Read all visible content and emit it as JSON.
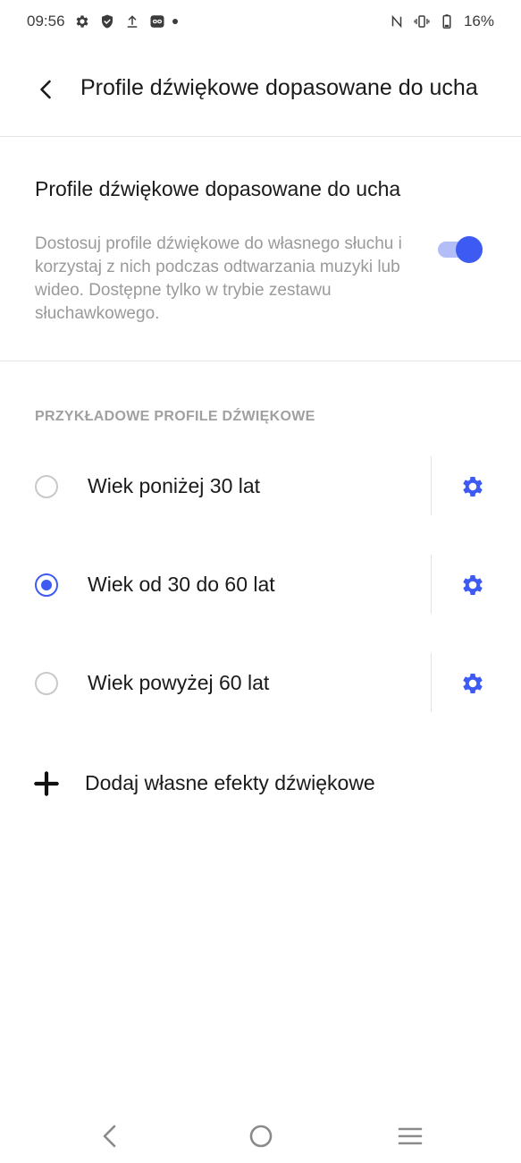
{
  "status_bar": {
    "time": "09:56",
    "left_icons": [
      "settings-icon",
      "shield-icon",
      "upload-icon",
      "link-app-icon",
      "notification-dot"
    ],
    "right_icons": [
      "nfc-icon",
      "vibrate-icon",
      "battery-icon"
    ],
    "battery": "16%"
  },
  "app_bar": {
    "title": "Profile dźwiękowe dopasowane do ucha"
  },
  "toggle_section": {
    "title": "Profile dźwiękowe dopasowane do ucha",
    "description": "Dostosuj profile dźwiękowe do własnego słuchu i korzystaj z nich podczas odtwarzania muzyki lub wideo. Dostępne tylko w trybie zestawu słuchawkowego.",
    "enabled": true
  },
  "profiles": {
    "header": "PRZYKŁADOWE PROFILE DŹWIĘKOWE",
    "items": [
      {
        "label": "Wiek poniżej 30 lat",
        "selected": false
      },
      {
        "label": "Wiek od 30 do 60 lat",
        "selected": true
      },
      {
        "label": "Wiek powyżej 60 lat",
        "selected": false
      }
    ]
  },
  "add_custom": {
    "label": "Dodaj własne efekty dźwiękowe"
  },
  "nav_bar": {
    "icons": [
      "back-nav-icon",
      "home-nav-icon",
      "menu-nav-icon"
    ]
  },
  "colors": {
    "accent": "#3d5bf2",
    "accent_light": "#b3bdf7",
    "secondary_text": "#9a9a9a",
    "divider": "#e3e3e3"
  }
}
